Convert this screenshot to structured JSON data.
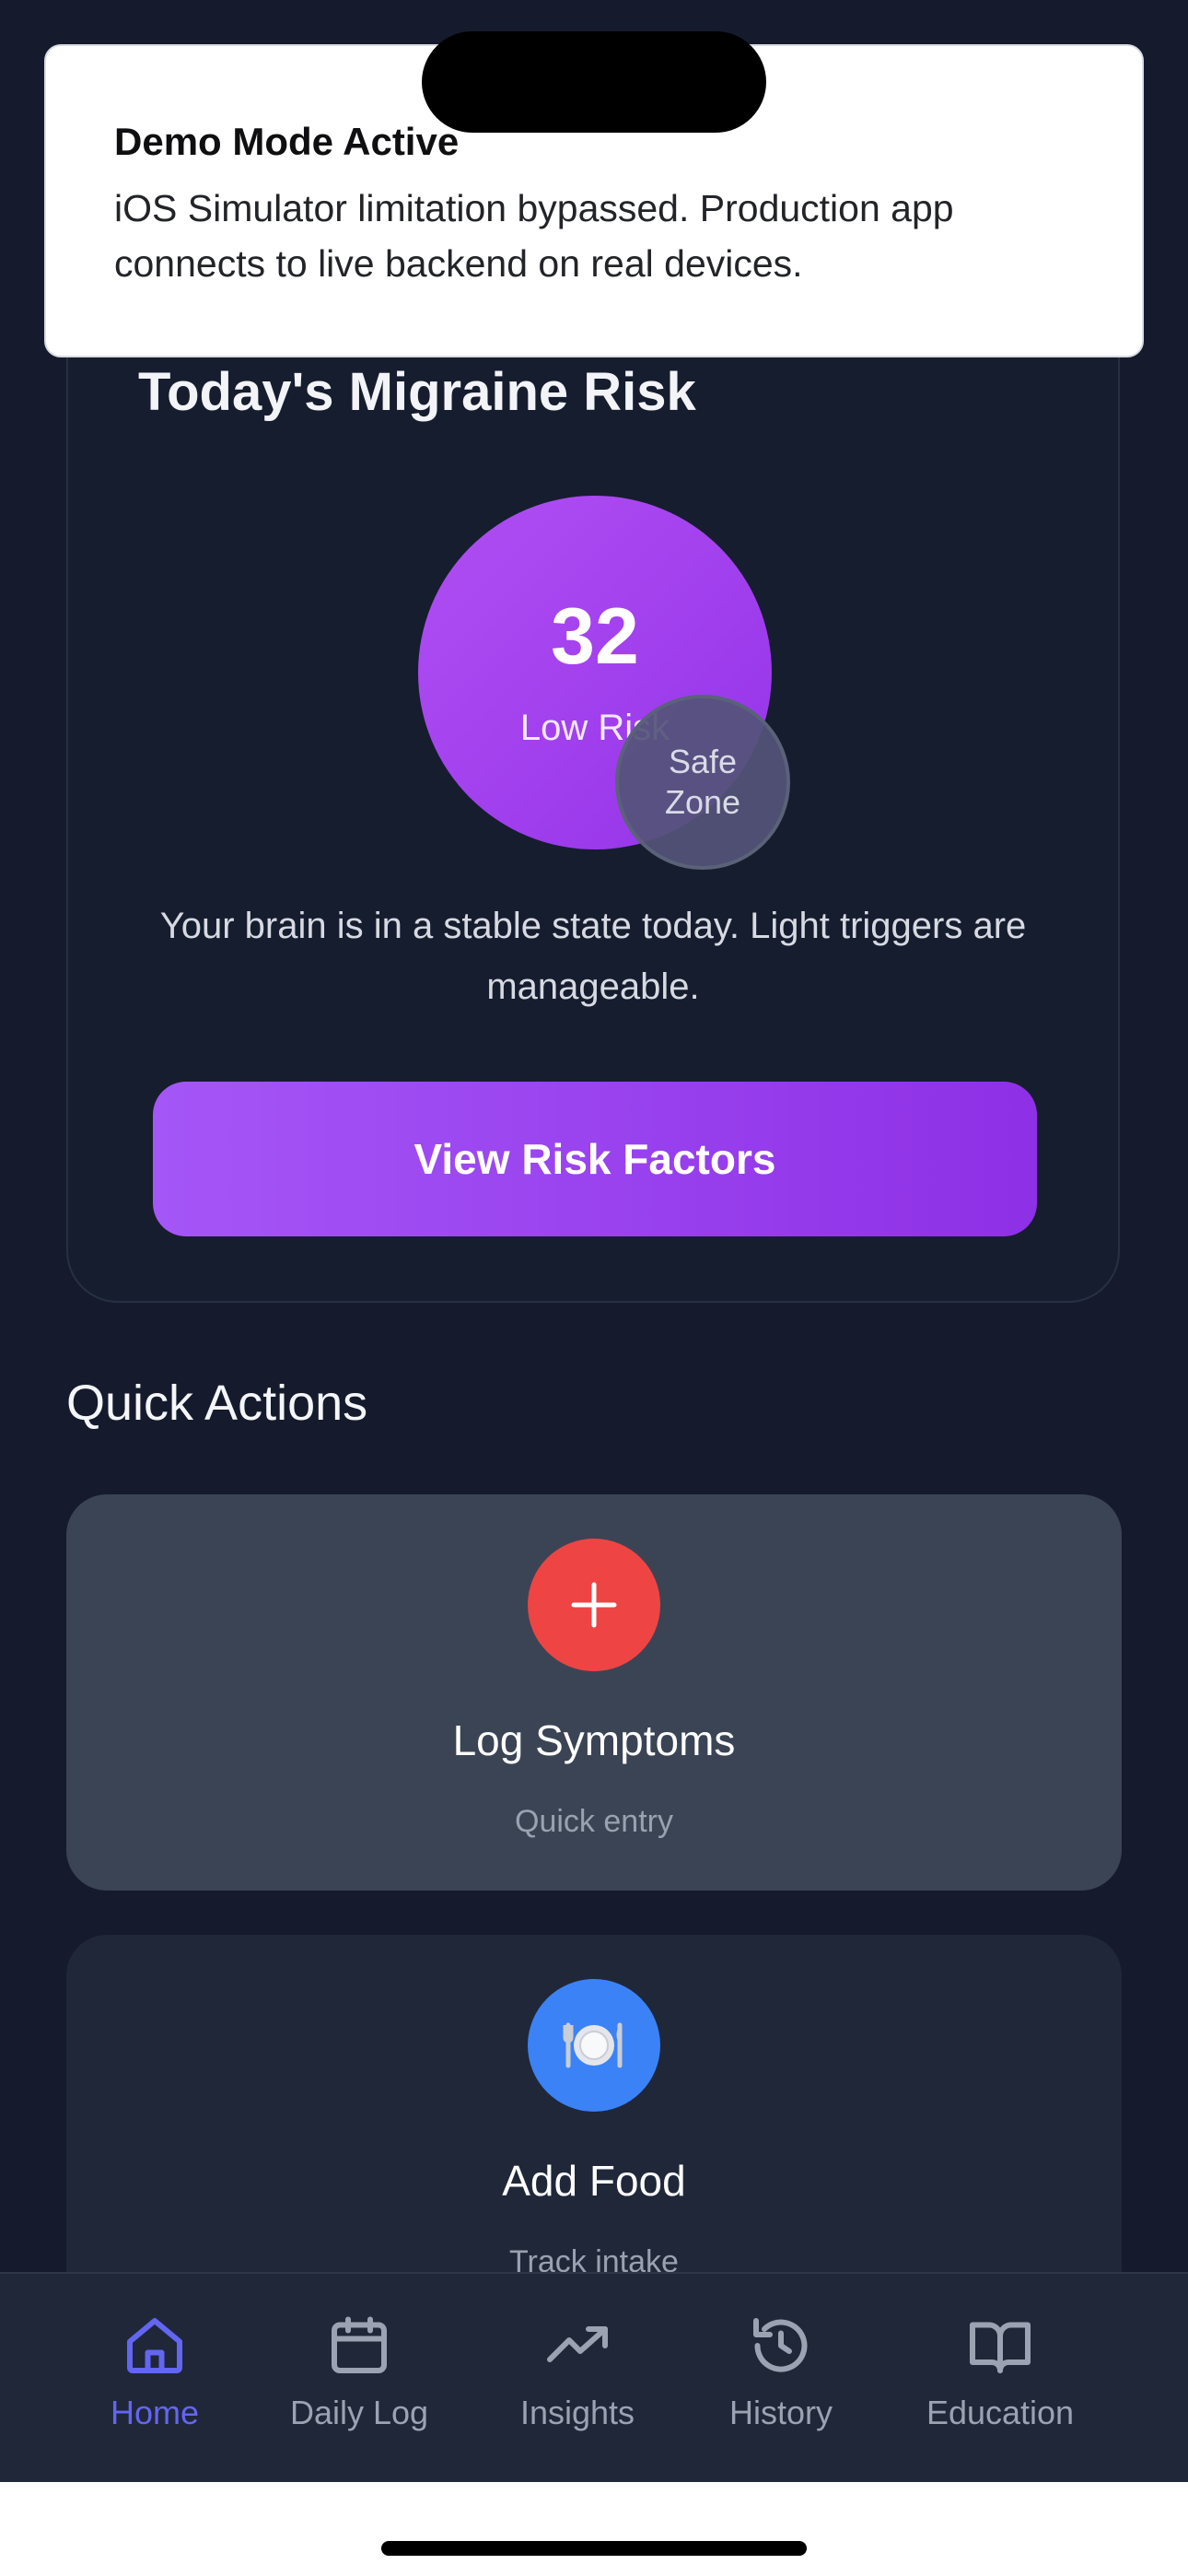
{
  "banner": {
    "title": "Demo Mode Active",
    "message": "iOS Simulator limitation bypassed. Production app connects to live backend on real devices."
  },
  "risk": {
    "title": "Today's Migraine Risk",
    "score": "32",
    "level": "Low Risk",
    "safe_zone_line1": "Safe",
    "safe_zone_line2": "Zone",
    "description": "Your brain is in a stable state today. Light triggers are manageable.",
    "button_label": "View Risk Factors",
    "colors": {
      "accent": "#a556f7",
      "accent_dark": "#8e30e6"
    }
  },
  "quick_actions": {
    "heading": "Quick Actions",
    "items": [
      {
        "title": "Log Symptoms",
        "subtitle": "Quick entry",
        "icon": "plus-icon",
        "color": "#ef4444"
      },
      {
        "title": "Add Food",
        "subtitle": "Track intake",
        "icon": "plate-icon",
        "color": "#3b82f6"
      }
    ]
  },
  "tabs": [
    {
      "label": "Home",
      "icon": "home-icon",
      "active": true
    },
    {
      "label": "Daily Log",
      "icon": "calendar-icon",
      "active": false
    },
    {
      "label": "Insights",
      "icon": "trending-up-icon",
      "active": false
    },
    {
      "label": "History",
      "icon": "history-icon",
      "active": false
    },
    {
      "label": "Education",
      "icon": "book-icon",
      "active": false
    }
  ],
  "colors": {
    "background": "#151b2c",
    "tab_active": "#6366f1",
    "tab_inactive": "#9ba3b3"
  }
}
